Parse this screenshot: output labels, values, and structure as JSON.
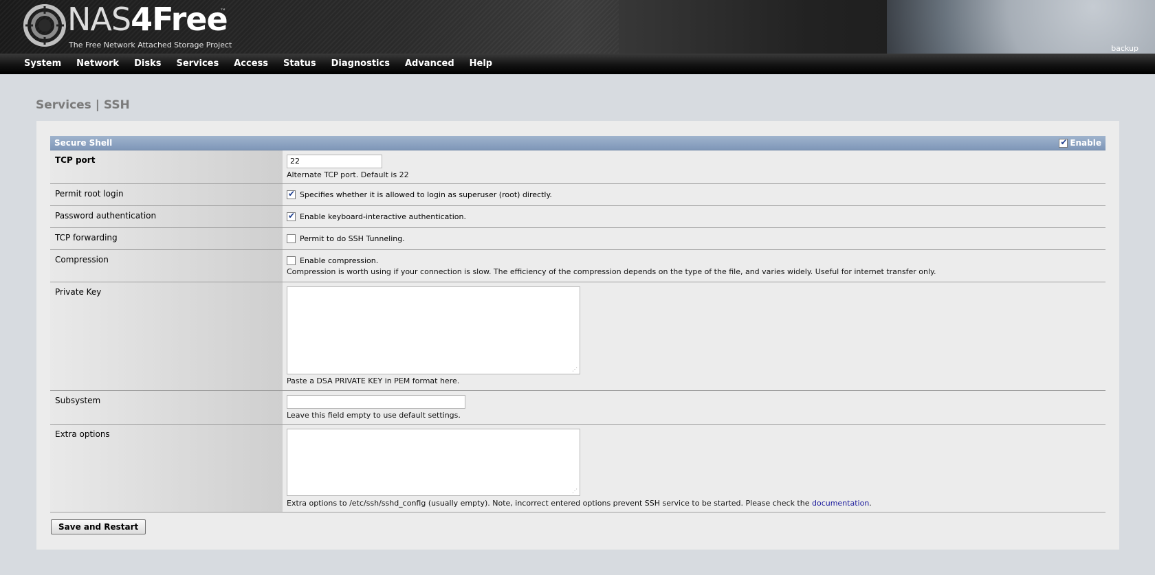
{
  "header": {
    "logo_main": "NAS",
    "logo_accent": "4Free",
    "trademark": "™",
    "tagline": "The Free Network Attached Storage Project",
    "hostname": "backup"
  },
  "nav": {
    "items": [
      "System",
      "Network",
      "Disks",
      "Services",
      "Access",
      "Status",
      "Diagnostics",
      "Advanced",
      "Help"
    ]
  },
  "page_title": "Services | SSH",
  "section": {
    "title": "Secure Shell",
    "enable_label": "Enable",
    "enabled": true
  },
  "fields": {
    "tcp_port": {
      "label": "TCP port",
      "value": "22",
      "desc": "Alternate TCP port. Default is 22"
    },
    "permit_root": {
      "label": "Permit root login",
      "checked": true,
      "text": "Specifies whether it is allowed to login as superuser (root) directly."
    },
    "password_auth": {
      "label": "Password authentication",
      "checked": true,
      "text": "Enable keyboard-interactive authentication."
    },
    "tcp_forwarding": {
      "label": "TCP forwarding",
      "checked": false,
      "text": "Permit to do SSH Tunneling."
    },
    "compression": {
      "label": "Compression",
      "checked": false,
      "text": "Enable compression.",
      "desc": "Compression is worth using if your connection is slow. The efficiency of the compression depends on the type of the file, and varies widely. Useful for internet transfer only."
    },
    "private_key": {
      "label": "Private Key",
      "value": "",
      "desc": "Paste a DSA PRIVATE KEY in PEM format here."
    },
    "subsystem": {
      "label": "Subsystem",
      "value": "",
      "desc": "Leave this field empty to use default settings."
    },
    "extra_options": {
      "label": "Extra options",
      "value": "",
      "desc": "Extra options to /etc/ssh/sshd_config (usually empty). Note, incorrect entered options prevent SSH service to be started. Please check the ",
      "link": "documentation",
      "desc_end": "."
    }
  },
  "save_button": "Save and Restart"
}
